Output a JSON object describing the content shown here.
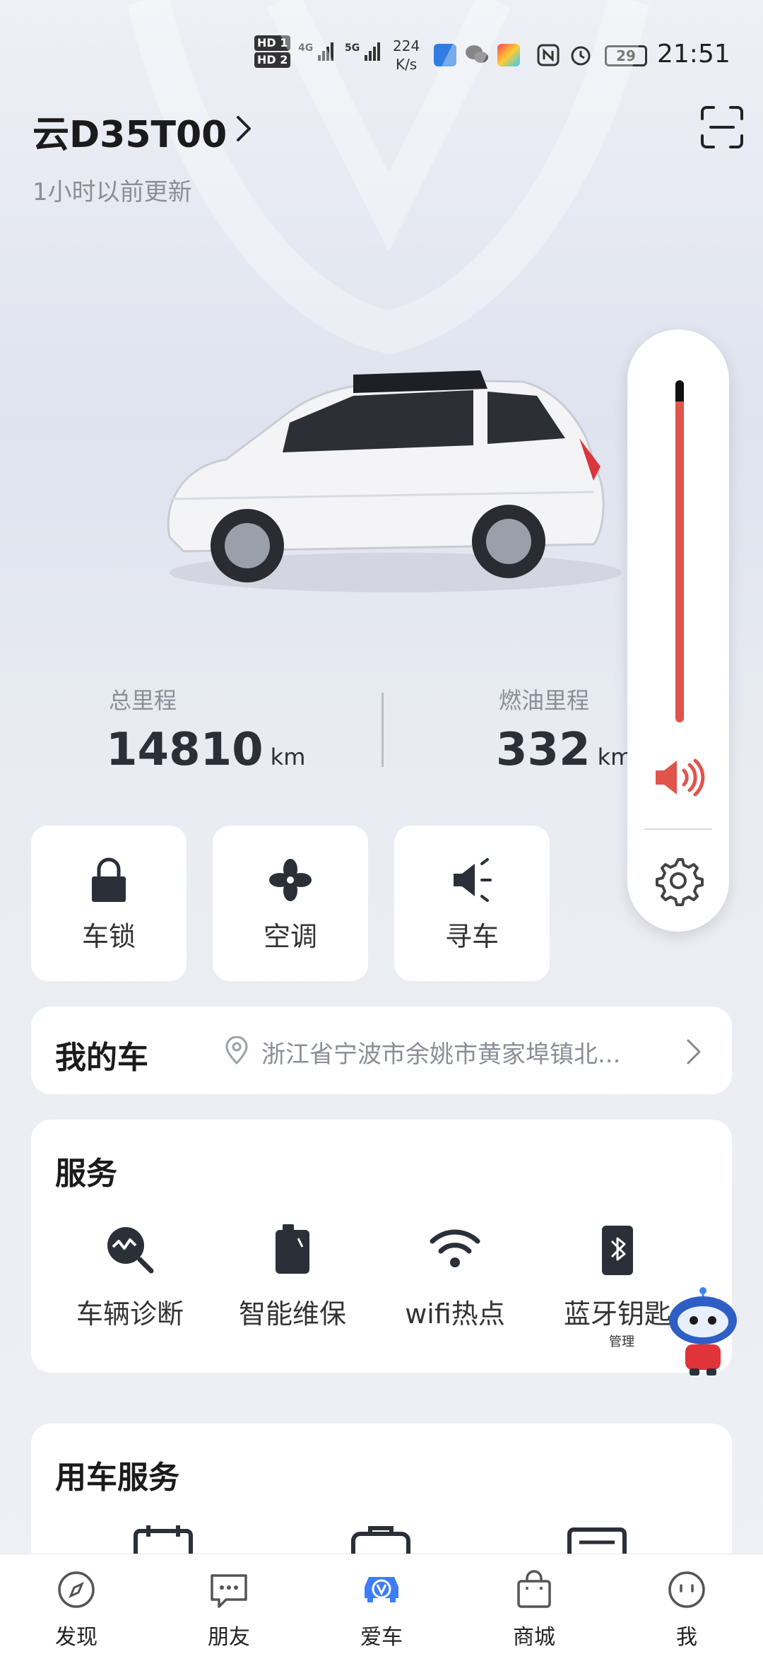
{
  "status_bar": {
    "hd1": "HD 1",
    "hd2": "HD 2",
    "net1": "4G",
    "net2": "5G",
    "speed_value": "224",
    "speed_unit": "K/s",
    "battery": "29",
    "time": "21:51"
  },
  "header": {
    "car_name": "云D35T00",
    "updated": "1小时以前更新"
  },
  "mileage": {
    "total_label": "总里程",
    "total_value": "14810",
    "total_unit": "km",
    "fuel_label": "燃油里程",
    "fuel_value": "332",
    "fuel_unit": "km"
  },
  "volume": {
    "level": 1.0
  },
  "quick_actions": [
    {
      "label": "车锁",
      "icon": "lock-icon"
    },
    {
      "label": "空调",
      "icon": "fan-icon"
    },
    {
      "label": "寻车",
      "icon": "horn-icon"
    }
  ],
  "my_car": {
    "title": "我的车",
    "address": "浙江省宁波市余姚市黄家埠镇北..."
  },
  "services": {
    "title": "服务",
    "items": [
      {
        "label": "车辆诊断",
        "icon": "diagnosis-icon"
      },
      {
        "label": "智能维保",
        "icon": "maintenance-icon"
      },
      {
        "label": "wifi热点",
        "icon": "wifi-icon"
      },
      {
        "label": "蓝牙钥匙",
        "icon": "bluetooth-key-icon"
      }
    ],
    "sub_label": "管理"
  },
  "car_services": {
    "title": "用车服务"
  },
  "bottom_nav": [
    {
      "label": "发现",
      "icon": "compass-icon",
      "active": false
    },
    {
      "label": "朋友",
      "icon": "chat-icon",
      "active": false
    },
    {
      "label": "爱车",
      "icon": "car-icon",
      "active": true
    },
    {
      "label": "商城",
      "icon": "shopping-bag-icon",
      "active": false
    },
    {
      "label": "我",
      "icon": "face-icon",
      "active": false
    }
  ],
  "colors": {
    "accent": "#3f7df6",
    "volume_fill": "#e0544b",
    "text_primary": "#1b1b1b",
    "text_secondary": "#8a8e96"
  }
}
